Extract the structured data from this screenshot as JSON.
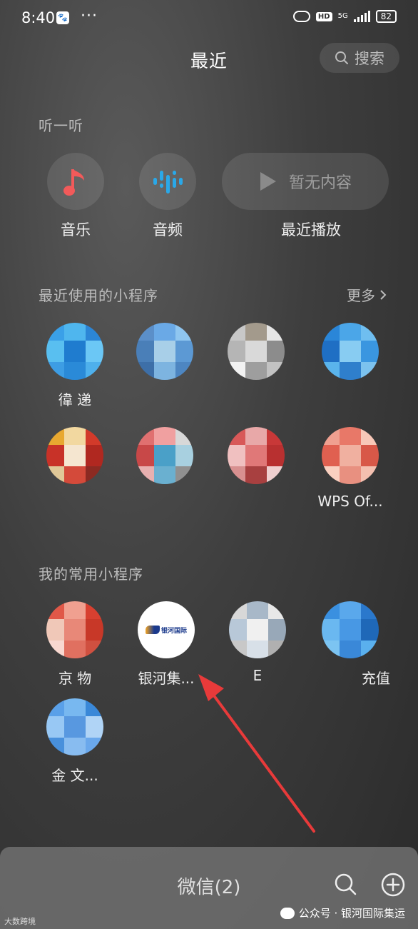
{
  "status_bar": {
    "time": "8:40",
    "dots": "···",
    "hd": "HD",
    "net": "5G",
    "battery": "82"
  },
  "header": {
    "title": "最近",
    "search_label": "搜索"
  },
  "listen": {
    "section_title": "听一听",
    "items": [
      {
        "label": "音乐"
      },
      {
        "label": "音频"
      }
    ],
    "recent_play": {
      "status": "暂无内容",
      "label": "最近播放"
    }
  },
  "recent_mini": {
    "section_title": "最近使用的小程序",
    "more_label": "更多",
    "apps": [
      {
        "label": "徫 递",
        "colors": [
          "#3aa0e8",
          "#4fb6ee",
          "#2c86d6",
          "#59bff0",
          "#1f7ccf",
          "#6bc7f5",
          "#3d9de4",
          "#2a8ad8",
          "#4eb0ec"
        ]
      },
      {
        "label": "",
        "colors": [
          "#5b8fc9",
          "#6aa9e6",
          "#8fc6f0",
          "#4a7fb8",
          "#a8cfe8",
          "#5c99d4",
          "#3d6fa8",
          "#7db4e0",
          "#4d86c2"
        ]
      },
      {
        "label": "",
        "colors": [
          "#c8c8c8",
          "#a39a8c",
          "#e6e6e6",
          "#b5b5b5",
          "#d9d9d9",
          "#8c8c8c",
          "#f2f2f2",
          "#9e9e9e",
          "#c2c2c2"
        ]
      },
      {
        "label": "",
        "colors": [
          "#2a86d8",
          "#4ba6e8",
          "#6fbef0",
          "#1f6fc4",
          "#88ccf2",
          "#3a96e0",
          "#5ab4ec",
          "#2f7fcc",
          "#7cc2ee"
        ]
      },
      {
        "label": "",
        "colors": [
          "#e8a830",
          "#f2d8a0",
          "#d23a2a",
          "#c83228",
          "#f5e6d0",
          "#b02820",
          "#e0c898",
          "#d44a3a",
          "#8c2a22"
        ]
      },
      {
        "label": "",
        "colors": [
          "#e07070",
          "#f0a0a0",
          "#d8d8d8",
          "#c84848",
          "#4aa0c8",
          "#a8d0e0",
          "#e8b0b0",
          "#6ab0d0",
          "#909090"
        ]
      },
      {
        "label": "",
        "colors": [
          "#d85858",
          "#e8a8a8",
          "#c83838",
          "#f0c0c0",
          "#e07878",
          "#b83030",
          "#d89090",
          "#a84040",
          "#f0d0d0"
        ]
      },
      {
        "label": "WPS Of...",
        "colors": [
          "#f0a090",
          "#e87868",
          "#f8c8b8",
          "#e06050",
          "#f0b0a0",
          "#d85848",
          "#fad0c0",
          "#e89080",
          "#f4c0b0"
        ]
      }
    ]
  },
  "frequent_mini": {
    "section_title": "我的常用小程序",
    "apps": [
      {
        "label": "京 物",
        "colors": [
          "#e05848",
          "#f0a090",
          "#d84030",
          "#f0c8b8",
          "#e88878",
          "#c83828",
          "#f8d8d0",
          "#e07060",
          "#d05040"
        ]
      },
      {
        "label": "银河集...",
        "logo": "银河国际"
      },
      {
        "label": "E ",
        "colors": [
          "#d8d8d8",
          "#a8b8c8",
          "#e8e8e8",
          "#b8c8d8",
          "#f0f0f0",
          "#98a8b8",
          "#c8c8c8",
          "#d8e0e8",
          "#b0b0b0"
        ]
      },
      {
        "label": "充值",
        "colors": [
          "#3a90e0",
          "#5aa8ec",
          "#2a78cc",
          "#6ab8f0",
          "#4898e4",
          "#1f68b8",
          "#7cc4f2",
          "#3a88d8",
          "#5ab0ee"
        ]
      },
      {
        "label": "金 文...",
        "colors": [
          "#5aa0e8",
          "#78b8f0",
          "#3a88d8",
          "#98c8f4",
          "#5898e0",
          "#b0d4f6",
          "#4890dc",
          "#88bcf0",
          "#6aa8ec"
        ]
      }
    ]
  },
  "bottom_bar": {
    "title": "微信(2)"
  },
  "watermark": {
    "left": "大数跨境",
    "right": "公众号 · 银河国际集运"
  },
  "colors": {
    "accent_red": "#f25a5a",
    "accent_blue": "#2aa8e8",
    "arrow_red": "#e83a3a"
  }
}
